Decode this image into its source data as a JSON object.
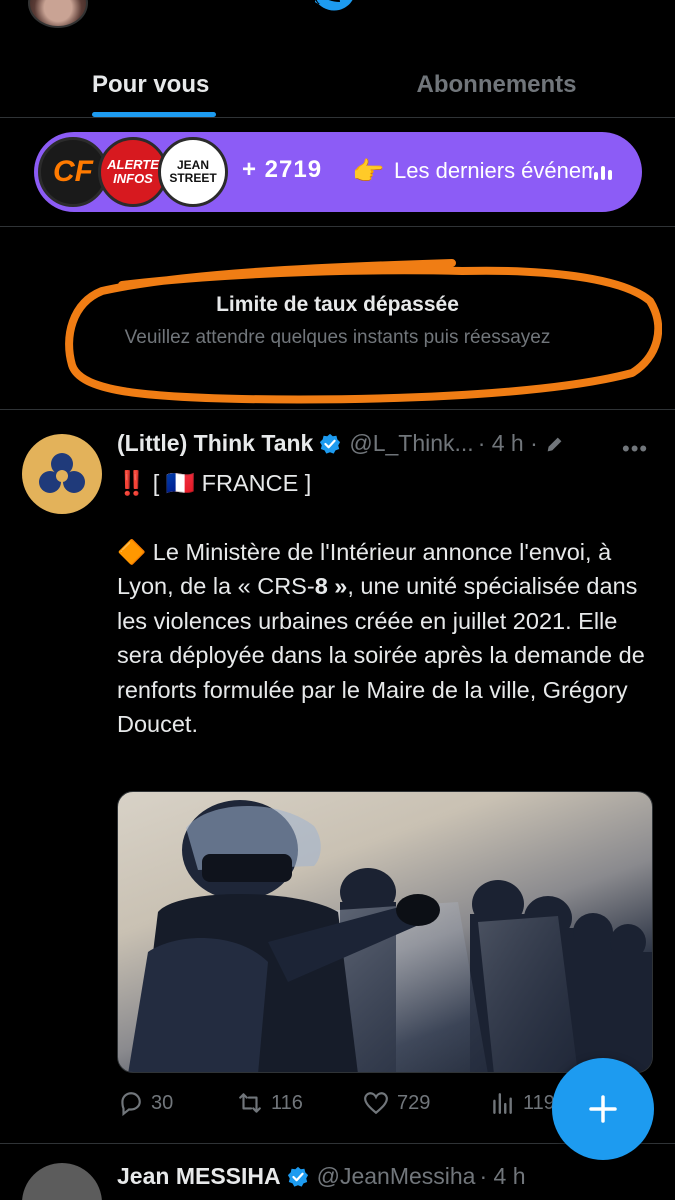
{
  "tabs": [
    {
      "label": "Pour vous",
      "active": true
    },
    {
      "label": "Abonnements",
      "active": false
    }
  ],
  "spaces": {
    "badge1": "CF",
    "badge2": "ALERTE INFOS",
    "badge3": "JEAN STREET",
    "count": "+ 2719",
    "hand": "👉",
    "text": "Les derniers événements"
  },
  "rate_limit": {
    "title": "Limite de taux dépassée",
    "subtitle": "Veuillez attendre quelques instants puis réessayez"
  },
  "tweet": {
    "name": "(Little) Think Tank",
    "handle": "@L_Think...",
    "time": "· 4 h ·",
    "line1_prefix": "‼️",
    "line1_flag": "[ 🇫🇷 FRANCE ]",
    "body_diamond": "🔶",
    "body_a": "Le Ministère de l'Intérieur annonce l'envoi, à Lyon, de la « CRS-",
    "body_bold": "8 »",
    "body_b": ", une unité spécialisée dans les violences urbaines créée en juillet 2021. Elle sera déployée dans la soirée après la demande de renforts formulée par le Maire de la ville, Grégory Doucet.",
    "replies": "30",
    "retweets": "116",
    "likes": "729",
    "views": "119"
  },
  "next_tweet": {
    "name": "Jean MESSIHA",
    "handle": "@JeanMessiha",
    "time": "· 4 h"
  },
  "colors": {
    "accent": "#1d9bf0",
    "spaces_bg": "#8c5cf6",
    "highlight_stroke": "#f07d14"
  }
}
